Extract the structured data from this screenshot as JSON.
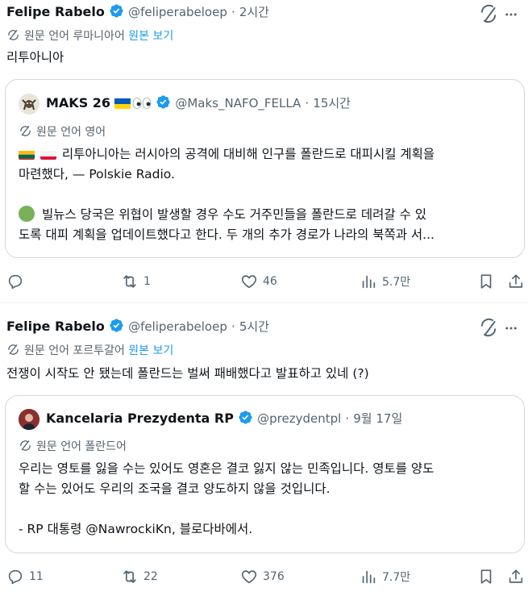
{
  "colors": {
    "accent": "#1d9bf0",
    "muted": "#536471",
    "text": "#0f1419",
    "border": "#cfd9de"
  },
  "posts": [
    {
      "author": {
        "name": "Felipe Rabelo",
        "handle": "@feliperabeloep",
        "sep": "·",
        "time": "2시간"
      },
      "translate": {
        "label": "원문 언어 루마니아어",
        "link": "원본 보기"
      },
      "text": "리투아니아",
      "quote": {
        "author": {
          "name": "MAKS 26",
          "emoji": "🇺🇦👀",
          "handle": "@Maks_NAFO_FELLA",
          "sep": "·",
          "time": "15시간"
        },
        "translate": {
          "label": "원문 언어 영어"
        },
        "lines": [
          "리투아니아는 러시아의 공격에 대비해 인구를 폴란드로 대피시킬 계획을",
          "마련했다, — Polskie Radio.",
          "",
          "빌뉴스 당국은 위협이 발생할 경우 수도 거주민들을 폴란드로 데려갈 수 있",
          "도록 대피 계획을 업데이트했다고 한다. 두 개의 추가 경로가 나라의 북쪽과 서..."
        ]
      },
      "actions": {
        "reply": "",
        "repost": "1",
        "like": "46",
        "views": "5.7만"
      }
    },
    {
      "author": {
        "name": "Felipe Rabelo",
        "handle": "@feliperabeloep",
        "sep": "·",
        "time": "5시간"
      },
      "translate": {
        "label": "원문 언어 포르투갈어",
        "link": "원본 보기"
      },
      "text": "전쟁이 시작도 안 됐는데 폴란드는 벌써 패배했다고 발표하고 있네 (?)",
      "quote": {
        "author": {
          "name": "Kancelaria Prezydenta RP",
          "handle": "@prezydentpl",
          "sep": "·",
          "time": "9월 17일"
        },
        "translate": {
          "label": "원문 언어 폴란드어"
        },
        "lines": [
          "우리는 영토를 잃을 수는 있어도 영혼은 결코 잃지 않는 민족입니다. 영토를 양도",
          "할 수는 있어도 우리의 조국을 결코 양도하지 않을 것입니다.",
          "",
          "- RP 대통령 @NawrockiKn, 블로다바에서."
        ]
      },
      "actions": {
        "reply": "11",
        "repost": "22",
        "like": "376",
        "views": "7.7만"
      }
    }
  ]
}
